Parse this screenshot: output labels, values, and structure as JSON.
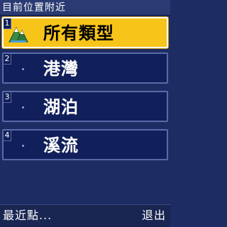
{
  "title": "目前位置附近",
  "items": [
    {
      "number": "1",
      "label": "所有類型",
      "selected": true,
      "icon": "all-types-mountain-icon"
    },
    {
      "number": "2",
      "label": "港灣",
      "selected": false
    },
    {
      "number": "3",
      "label": "湖泊",
      "selected": false
    },
    {
      "number": "4",
      "label": "溪流",
      "selected": false
    }
  ],
  "softkeys": {
    "left": "最近點...",
    "right": "退出"
  },
  "colors": {
    "background": "#1d2d63",
    "selected": "#f7c51a",
    "item_border": "#5a6aa8"
  }
}
